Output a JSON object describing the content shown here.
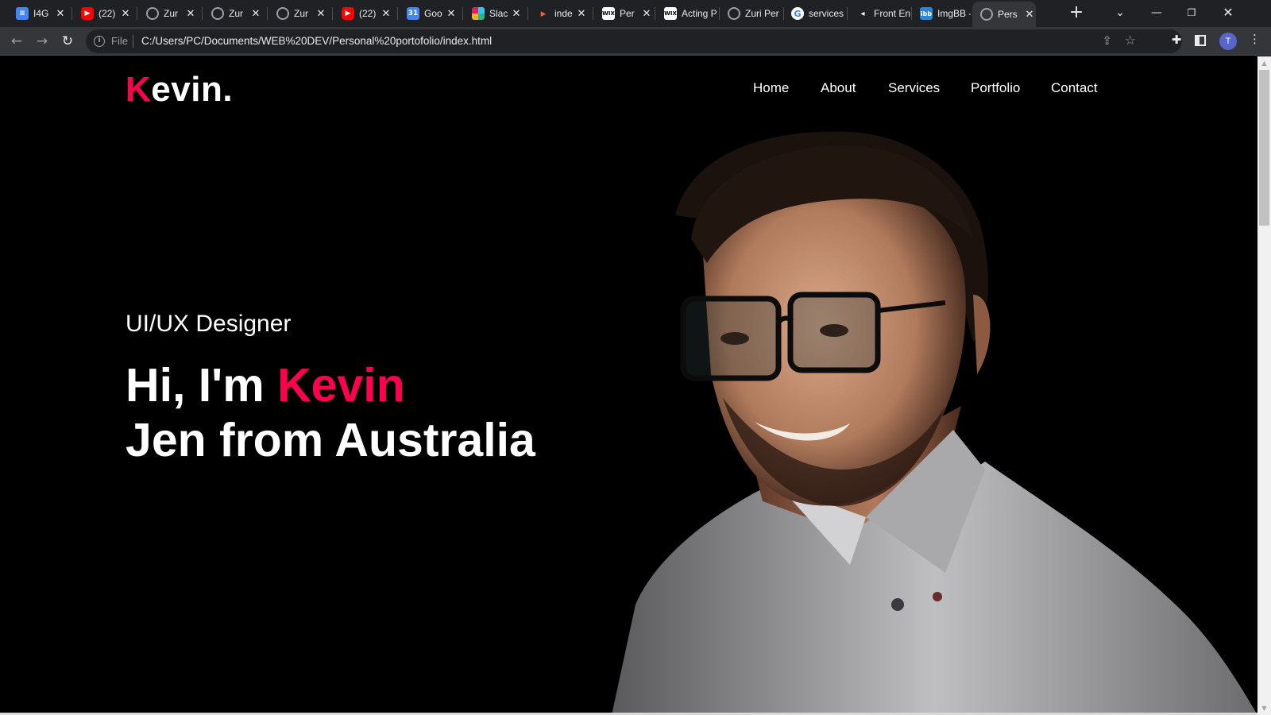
{
  "browser": {
    "tabs": [
      {
        "title": "I4G",
        "icon": "google-docs-icon",
        "color": "#4285f4"
      },
      {
        "title": "(22)",
        "icon": "youtube-icon",
        "color": "#ff0000"
      },
      {
        "title": "Zur",
        "icon": "globe-icon",
        "color": "#9aa0a6"
      },
      {
        "title": "Zur",
        "icon": "globe-icon",
        "color": "#9aa0a6"
      },
      {
        "title": "Zur",
        "icon": "globe-icon",
        "color": "#9aa0a6"
      },
      {
        "title": "(22)",
        "icon": "youtube-icon",
        "color": "#ff0000"
      },
      {
        "title": "Goo",
        "icon": "google-calendar-icon",
        "color": "#4285f4"
      },
      {
        "title": "Slac",
        "icon": "slack-icon",
        "color": "#e01e5a"
      },
      {
        "title": "inde",
        "icon": "arrow-icon",
        "color": "#f26522"
      },
      {
        "title": "Per",
        "icon": "wix-icon",
        "color": "#ffffff"
      },
      {
        "title": "Acting P",
        "icon": "wix-icon",
        "color": "#ffffff"
      },
      {
        "title": "Zuri Per",
        "icon": "globe-icon",
        "color": "#9aa0a6"
      },
      {
        "title": "services",
        "icon": "google-icon",
        "color": "#4285f4"
      },
      {
        "title": "Front En",
        "icon": "frontend-mentor-icon",
        "color": "#ffffff"
      },
      {
        "title": "ImgBB -",
        "icon": "imgbb-icon",
        "color": "#2a87d8"
      },
      {
        "title": "Pers",
        "icon": "globe-icon",
        "color": "#9aa0a6",
        "active": true
      }
    ],
    "new_tab_label": "+",
    "url_scheme": "File",
    "url": "C:/Users/PC/Documents/WEB%20DEV/Personal%20portofolio/index.html",
    "profile_initial": "T"
  },
  "page": {
    "logo_first_letter": "K",
    "logo_rest": "evin.",
    "nav": [
      "Home",
      "About",
      "Services",
      "Portfolio",
      "Contact"
    ],
    "role": "UI/UX Designer",
    "greeting": "Hi, I'm ",
    "name": "Kevin",
    "headline_line2": "Jen from Australia",
    "accent_color": "#ff004f"
  }
}
